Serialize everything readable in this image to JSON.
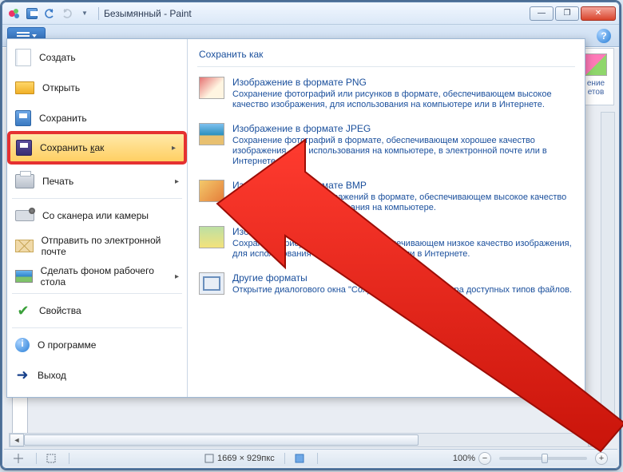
{
  "window": {
    "title": "Безымянный - Paint"
  },
  "ribbon": {
    "hidden_group_label": "ение\nетов"
  },
  "menu": {
    "items": [
      {
        "id": "new",
        "label": "Создать"
      },
      {
        "id": "open",
        "label": "Открыть"
      },
      {
        "id": "save",
        "label": "Сохранить"
      },
      {
        "id": "saveas",
        "label": "Сохранить как",
        "has_sub": true,
        "highlighted": true,
        "underline_index": 10
      },
      {
        "id": "print",
        "label": "Печать",
        "has_sub": true
      },
      {
        "id": "scanner",
        "label": "Со сканера или камеры"
      },
      {
        "id": "mail",
        "label": "Отправить по электронной почте"
      },
      {
        "id": "desktop",
        "label": "Сделать фоном рабочего стола",
        "has_sub": true
      },
      {
        "id": "props",
        "label": "Свойства"
      },
      {
        "id": "about",
        "label": "О программе"
      },
      {
        "id": "exit",
        "label": "Выход"
      }
    ],
    "submenu": {
      "title": "Сохранить как",
      "options": [
        {
          "id": "png",
          "title": "Изображение в формате PNG",
          "desc": "Сохранение фотографий или рисунков в формате, обеспечивающем высокое качество изображения, для использования на компьютере или в Интернете."
        },
        {
          "id": "jpeg",
          "title": "Изображение в формате JPEG",
          "desc": "Сохранение фотографий в формате, обеспечивающем хорошее качество изображения, для использования на компьютере, в электронной почте или в Интернете."
        },
        {
          "id": "bmp",
          "title": "Изображение в формате BMP",
          "desc": "Сохранение любых изображений в формате, обеспечивающем высокое качество изображения, для использования на компьютере."
        },
        {
          "id": "gif",
          "title": "Изображение в формате GIF",
          "desc": "Сохранение рисунков в формате, обеспечивающем низкое качество изображения, для использования в электронной почте или в Интернете."
        },
        {
          "id": "other",
          "title": "Другие форматы",
          "desc": "Открытие диалогового окна \"Сохранить как\" для выбора доступных типов файлов."
        }
      ]
    }
  },
  "statusbar": {
    "pointer": "",
    "selection": "",
    "dimensions": "1669 × 929пкс",
    "filesize": "",
    "zoom": "100%"
  },
  "glyphs": {
    "minus": "−",
    "plus": "+",
    "left": "◄",
    "right": "►",
    "sub_arrow": "▸",
    "cross": "✕",
    "check": "✔",
    "exit": "➜",
    "maximize": "❐",
    "minimize": "—"
  }
}
